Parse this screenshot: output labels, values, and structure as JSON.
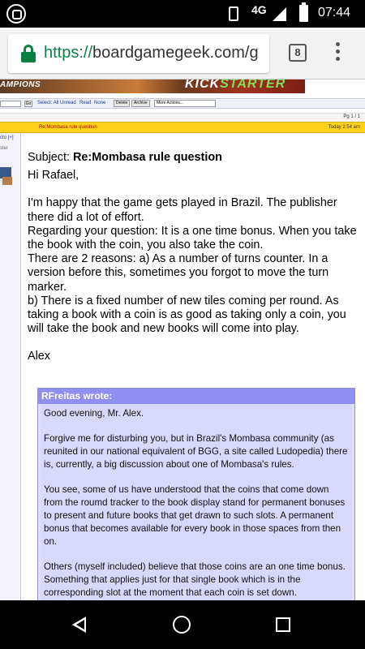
{
  "status_bar": {
    "network": "4G",
    "time": "07:44"
  },
  "browser": {
    "url_scheme": "https://",
    "url_host": "boardgamegeek.com/g",
    "tab_count": "8"
  },
  "banner": {
    "left_text": "AMPIONS",
    "kickstarter_a": "KICK",
    "kickstarter_b": "STARTER"
  },
  "toolbar": {
    "go_label": "Go",
    "links": [
      "Select: All",
      "Unread",
      "Read",
      "None"
    ],
    "delete_label": "Delete",
    "archive_label": "Archive",
    "more_actions_label": "More Actions..."
  },
  "page_indicator": "Pg 1 / 1",
  "subject_bar": {
    "subject": "Re:Mombasa rule question",
    "date": "Today 2:54 am"
  },
  "sidebar": {
    "link": "cto [+]",
    "role": "ster"
  },
  "message": {
    "subject_label": "Subject: ",
    "subject": "Re:Mombasa rule question",
    "greeting": "Hi Rafael,",
    "paragraph1": "I'm happy that the game gets played in Brazil. The publisher there did a lot of effort.",
    "paragraph2": "Regarding your question: It is a one time bonus. When you take the book with the coin, you also take the coin.",
    "paragraph3": "There are 2 reasons: a) As a number of turns counter. In a version before this, sometimes you forgot to move the turn marker.",
    "paragraph4": "b) There is a fixed number of new tiles coming per round. As taking a book with a coin is as good as taking only a coin, you will take the book and new books will come into play.",
    "signature": "Alex"
  },
  "quote": {
    "author": "RFreitas wrote:",
    "p1": "Good evening, Mr. Alex.",
    "p2": "Forgive me for disturbing you, but in Brazil's Mombasa community (as reunited in our national equivalent of BGG, a site called Ludopedia) there is, currently, a big discussion about one of Mombasa's rules.",
    "p3": "You see, some of us have understood that the coins that come down from the roumd tracker to the book display stand for permanent bonuses to present and future books that get drawn to such slots. A permanent bonus that becomes available for every book in those spaces from then on.",
    "p4": "Others (myself included) believe that those coins are an one time bonus. Something that applies just for that single book which is in the corresponding slot at the moment that each coin is set down."
  }
}
